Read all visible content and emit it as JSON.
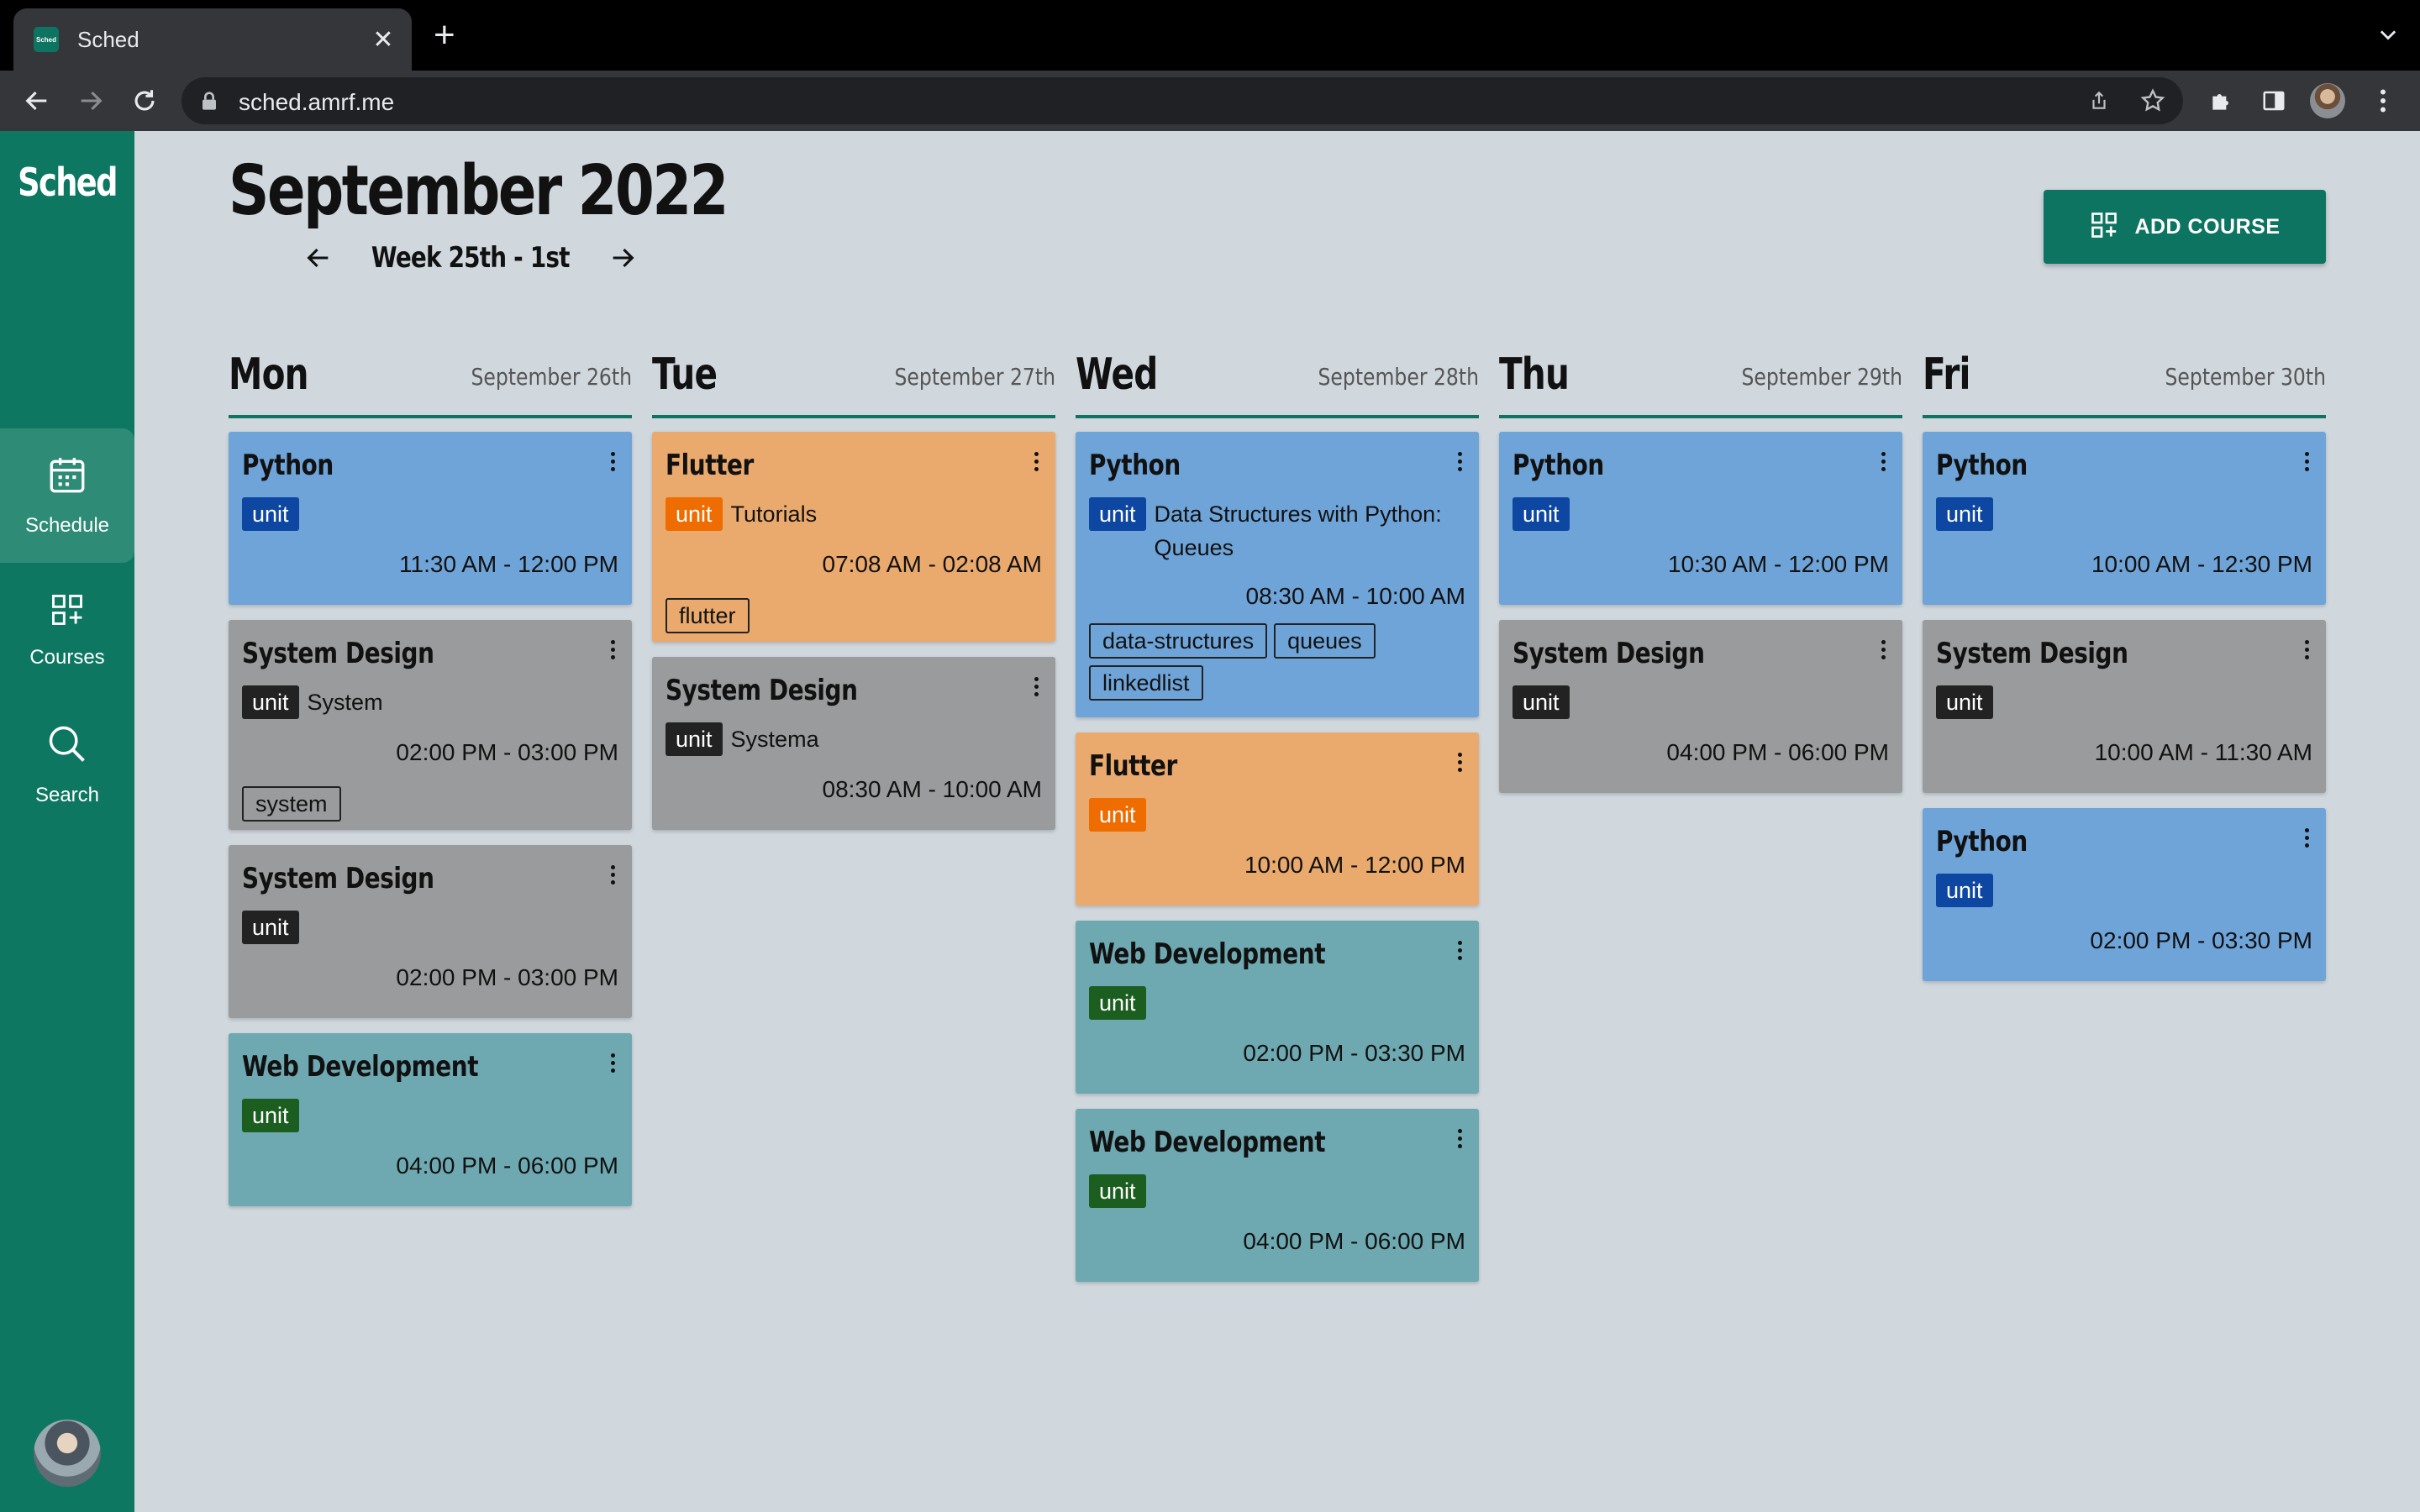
{
  "browser": {
    "tab_title": "Sched",
    "favicon_text": "Sched",
    "url": "sched.amrf.me"
  },
  "sidebar": {
    "logo": "Sched",
    "items": [
      {
        "label": "Schedule",
        "icon": "calendar-icon",
        "active": true
      },
      {
        "label": "Courses",
        "icon": "grid-plus-icon",
        "active": false
      },
      {
        "label": "Search",
        "icon": "search-icon",
        "active": false
      }
    ]
  },
  "header": {
    "month": "September 2022",
    "week": "Week 25th - 1st",
    "add_course": "ADD COURSE"
  },
  "colors": {
    "accent": "#0d7461",
    "python": "#6fa4d9",
    "system_design": "#999b9c",
    "flutter": "#eaaa6e",
    "web_development": "#6ea9b1"
  },
  "days": [
    {
      "name": "Mon",
      "date": "September 26th",
      "courses": [
        {
          "title": "Python",
          "unit": "unit",
          "desc": "",
          "time": "11:30 AM - 12:00 PM",
          "tags": []
        },
        {
          "title": "System Design",
          "unit": "unit",
          "desc": "System",
          "time": "02:00 PM - 03:00 PM",
          "tags": [
            "system"
          ]
        },
        {
          "title": "System Design",
          "unit": "unit",
          "desc": "",
          "time": "02:00 PM - 03:00 PM",
          "tags": []
        },
        {
          "title": "Web Development",
          "unit": "unit",
          "desc": "",
          "time": "04:00 PM - 06:00 PM",
          "tags": []
        }
      ]
    },
    {
      "name": "Tue",
      "date": "September 27th",
      "courses": [
        {
          "title": "Flutter",
          "unit": "unit",
          "desc": "Tutorials",
          "time": "07:08 AM - 02:08 AM",
          "tags": [
            "flutter"
          ]
        },
        {
          "title": "System Design",
          "unit": "unit",
          "desc": "Systema",
          "time": "08:30 AM - 10:00 AM",
          "tags": []
        }
      ]
    },
    {
      "name": "Wed",
      "date": "September 28th",
      "courses": [
        {
          "title": "Python",
          "unit": "unit",
          "desc_line1": "Data Structures with Python:",
          "desc_line2": "Queues",
          "time": "08:30 AM - 10:00 AM",
          "tags": [
            "data-structures",
            "queues",
            "linkedlist"
          ]
        },
        {
          "title": "Flutter",
          "unit": "unit",
          "desc": "",
          "time": "10:00 AM - 12:00 PM",
          "tags": []
        },
        {
          "title": "Web Development",
          "unit": "unit",
          "desc": "",
          "time": "02:00 PM - 03:30 PM",
          "tags": []
        },
        {
          "title": "Web Development",
          "unit": "unit",
          "desc": "",
          "time": "04:00 PM - 06:00 PM",
          "tags": []
        }
      ]
    },
    {
      "name": "Thu",
      "date": "September 29th",
      "courses": [
        {
          "title": "Python",
          "unit": "unit",
          "desc": "",
          "time": "10:30 AM - 12:00 PM",
          "tags": []
        },
        {
          "title": "System Design",
          "unit": "unit",
          "desc": "",
          "time": "04:00 PM - 06:00 PM",
          "tags": []
        }
      ]
    },
    {
      "name": "Fri",
      "date": "September 30th",
      "courses": [
        {
          "title": "Python",
          "unit": "unit",
          "desc": "",
          "time": "10:00 AM - 12:30 PM",
          "tags": []
        },
        {
          "title": "System Design",
          "unit": "unit",
          "desc": "",
          "time": "10:00 AM - 11:30 AM",
          "tags": []
        },
        {
          "title": "Python",
          "unit": "unit",
          "desc": "",
          "time": "02:00 PM - 03:30 PM",
          "tags": []
        }
      ]
    }
  ]
}
